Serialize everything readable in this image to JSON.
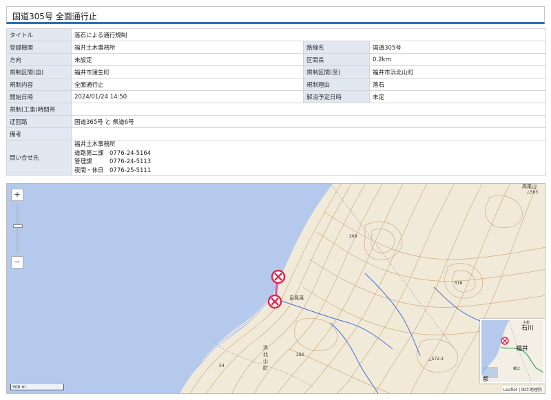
{
  "header": {
    "title": "国道305号 全面通行止"
  },
  "info": {
    "title_label": "タイトル",
    "title_value": "落石による通行規制",
    "registrar_label": "登録機関",
    "registrar_value": "福井土木事務所",
    "route_label": "路線名",
    "route_value": "国道305号",
    "direction_label": "方向",
    "direction_value": "未設定",
    "length_label": "区間長",
    "length_value": "0.2km",
    "from_label": "規制区間(自)",
    "from_value": "福井市蒲生町",
    "to_label": "規制区間(至)",
    "to_value": "福井市浜北山町",
    "content_label": "規制内容",
    "content_value": "全面通行止",
    "reason_label": "規制理由",
    "reason_value": "落石",
    "start_label": "開始日時",
    "start_value": "2024/01/24 14:50",
    "end_label": "解消予定日時",
    "end_value": "未定",
    "hours_label": "規制(工事)時間帯",
    "hours_value": "",
    "detour_label": "迂回路",
    "detour_value": "国道365号 と 県道6号",
    "remarks_label": "備考",
    "remarks_value": "",
    "contact_label": "問い合せ先",
    "contact_lines": [
      "福井土木事務所",
      "道路第二課　0776-24-5164",
      "管理課　　　0776-24-5113",
      "夜間・休日　0776-25-5111"
    ]
  },
  "map": {
    "zoom_in": "+",
    "zoom_out": "−",
    "scale_label": "500 m",
    "attribution": "Leaflet | 国土地理院",
    "labels": {
      "place_ashimidaki": "足見滝",
      "place_hamakita_1": "浜",
      "place_hamakita_2": "北",
      "place_hamakita_3": "山",
      "place_hamakita_4": "町",
      "elev_269": "269",
      "elev_516": "516",
      "elev_292": "292",
      "elev_572": "△572.3",
      "elev_54": "54",
      "elev_563": "△563",
      "corner_text": "高尾山"
    },
    "mini_labels": {
      "ishikawa": "石川",
      "fukui": "福井",
      "komatsu": "小松",
      "sabae": "鯖江",
      "miyako": "都"
    },
    "colors": {
      "sea": "#b4c9ec",
      "land": "#f2ead8",
      "contour": "#c9a47a",
      "river": "#3f6fd6",
      "road": "#b06bc8",
      "marker": "#e0284f"
    }
  }
}
